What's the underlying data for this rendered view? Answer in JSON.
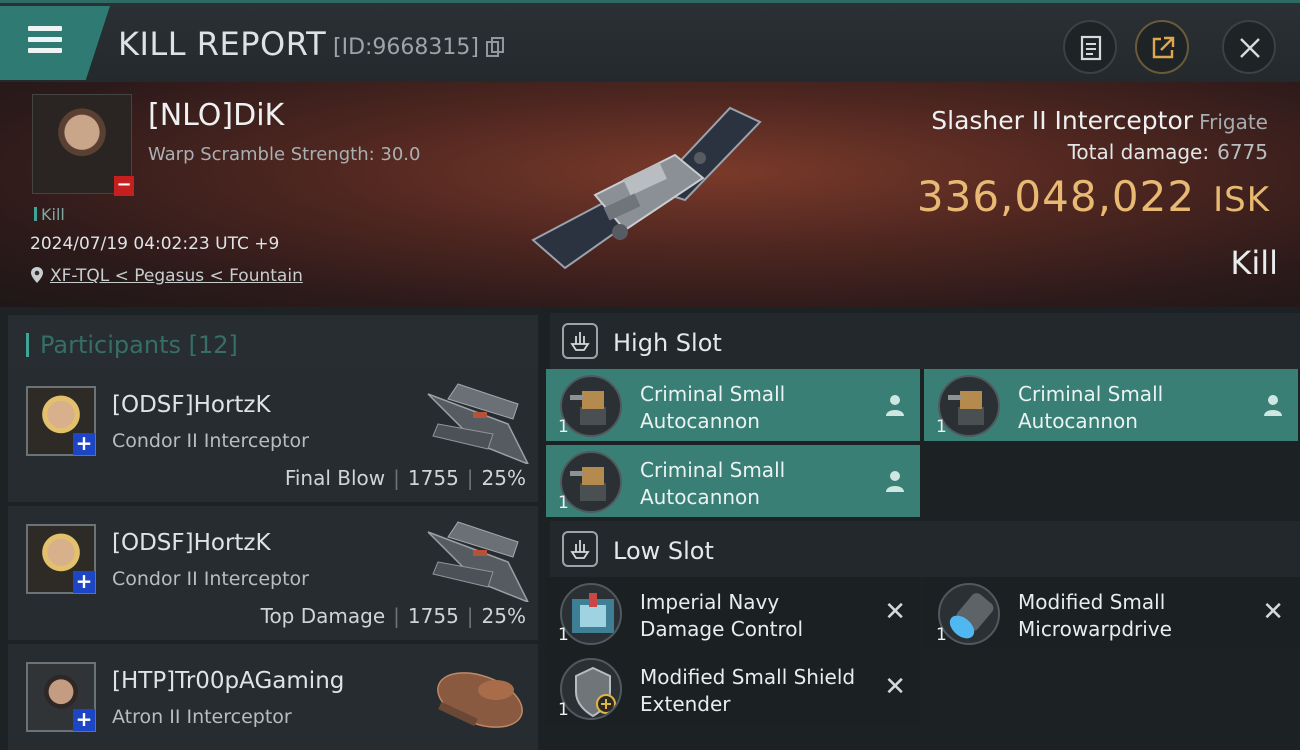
{
  "header": {
    "title": "KILL REPORT",
    "report_id": "[ID:9668315]",
    "icons": [
      "menu-icon",
      "copy-icon",
      "clipboard-icon",
      "export-icon",
      "close-icon"
    ]
  },
  "victim": {
    "pilot": "[NLO]DiK",
    "warp_scramble": "Warp Scramble Strength: 30.0",
    "tag": "Kill",
    "datetime": "2024/07/19 04:02:23 UTC +9",
    "location": "XF-TQL < Pegasus < Fountain",
    "ship_name": "Slasher II Interceptor",
    "ship_class": "Frigate",
    "total_damage_label": "Total damage:",
    "total_damage_value": "6775",
    "isk_value": "336,048,022",
    "isk_unit": "ISK",
    "result": "Kill"
  },
  "participants": {
    "title": "Participants [12]",
    "rows": [
      {
        "name": "[ODSF]HortzK",
        "ship": "Condor II Interceptor",
        "role": "Final Blow",
        "damage": "1755",
        "percent": "25%"
      },
      {
        "name": "[ODSF]HortzK",
        "ship": "Condor II Interceptor",
        "role": "Top Damage",
        "damage": "1755",
        "percent": "25%"
      },
      {
        "name": "[HTP]Tr00pAGaming",
        "ship": "Atron II Interceptor",
        "role": "",
        "damage": "",
        "percent": ""
      }
    ]
  },
  "fitting": {
    "high_slot_label": "High Slot",
    "low_slot_label": "Low Slot",
    "high_slot": [
      {
        "name_line1": "Criminal Small",
        "name_line2": "Autocannon",
        "qty": "1",
        "state": "active"
      },
      {
        "name_line1": "Criminal Small",
        "name_line2": "Autocannon",
        "qty": "1",
        "state": "active"
      },
      {
        "name_line1": "Criminal Small",
        "name_line2": "Autocannon",
        "qty": "1",
        "state": "active"
      }
    ],
    "low_slot": [
      {
        "name_line1": "Imperial Navy",
        "name_line2": "Damage Control",
        "qty": "1",
        "state": "destroyed"
      },
      {
        "name_line1": "Modified Small",
        "name_line2": "Microwarpdrive",
        "qty": "1",
        "state": "destroyed"
      },
      {
        "name_line1": "Modified Small Shield",
        "name_line2": "Extender",
        "qty": "1",
        "state": "destroyed"
      }
    ]
  },
  "colors": {
    "accent_teal": "#3fa596",
    "active_module": "#3a7f76",
    "isk_gold": "#e7b972",
    "minus_badge": "#c51f1f",
    "plus_badge": "#1c46c5"
  }
}
